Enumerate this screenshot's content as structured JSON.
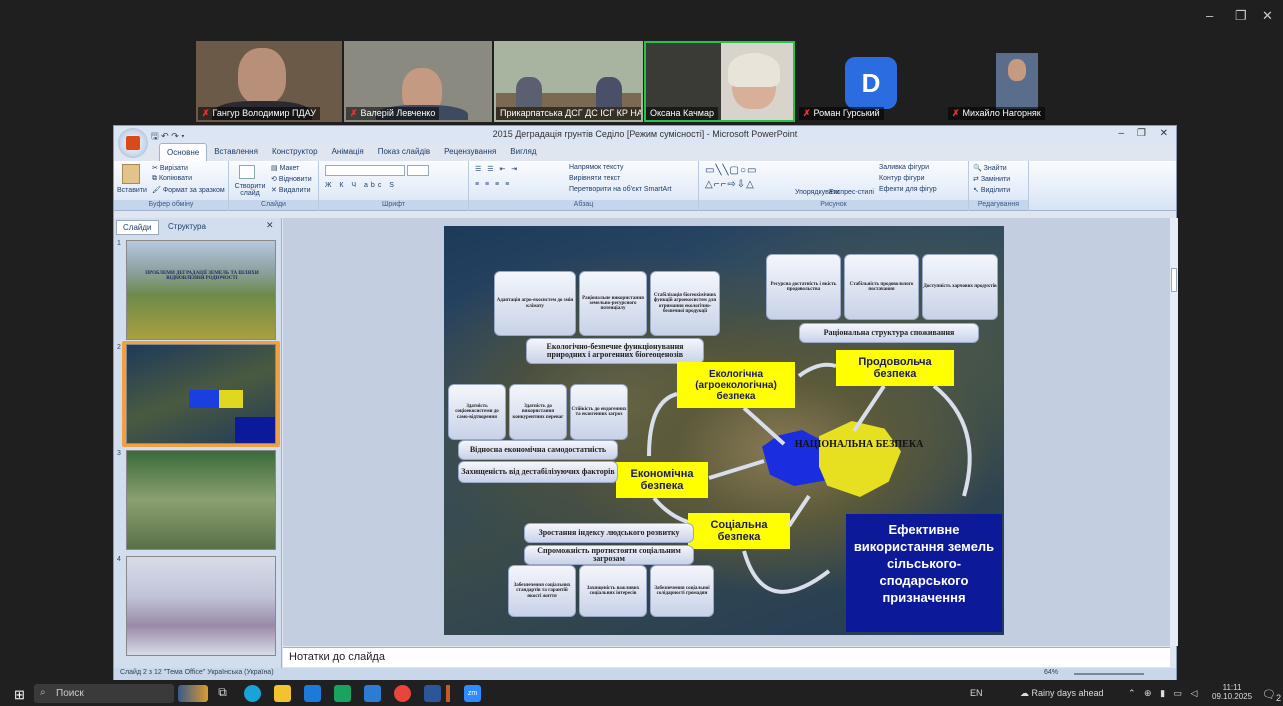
{
  "zoom_window": {
    "controls": [
      "–",
      "❐",
      "✕"
    ],
    "participants": [
      {
        "name": "Гангур Володимир ПДАУ"
      },
      {
        "name": "Валерій Левченко"
      },
      {
        "name": "Прикарпатська ДСГ ДС ІСГ КР НАА..."
      },
      {
        "name": "Оксана Качмар"
      },
      {
        "name": "Роман Гурський"
      },
      {
        "name": "Михайло Нагорняк"
      }
    ]
  },
  "ppt": {
    "title": "2015 Деградація грунтів Седіло [Режим сумісності] - Microsoft PowerPoint",
    "office_button": "",
    "window_controls": [
      "–",
      "❐",
      "✕"
    ],
    "tabs": [
      "Основне",
      "Вставлення",
      "Конструктор",
      "Анімація",
      "Показ слайдів",
      "Рецензування",
      "Вигляд"
    ],
    "ribbon": {
      "clipboard": {
        "paste": "Вставити",
        "cut": "Вирізати",
        "copy": "Копіювати",
        "format": "Формат за зразком",
        "label": "Буфер обміну"
      },
      "slides": {
        "new": "Створити слайд",
        "layout": "Макет",
        "reset": "Відновити",
        "delete": "Видалити",
        "label": "Слайди"
      },
      "font": {
        "label": "Шрифт"
      },
      "paragraph": {
        "dir": "Напрямок тексту",
        "align": "Вирівняти текст",
        "smart": "Перетворити на об'єкт SmartArt",
        "label": "Абзац"
      },
      "drawing": {
        "arrange": "Упорядкувати",
        "styles": "Експрес-стилі",
        "fill": "Заливка фігури",
        "outline": "Контур фігури",
        "effects": "Ефекти для фігур",
        "label": "Рисунок"
      },
      "editing": {
        "find": "Знайти",
        "replace": "Замінити",
        "select": "Виділити",
        "label": "Редагування"
      }
    },
    "panel_tabs": [
      "Слайди",
      "Структура"
    ],
    "thumb_numbers": [
      "1",
      "2",
      "3",
      "4"
    ],
    "thumb1_title": "ПРОБЛЕМИ ДЕГРАДАЦІЇ ЗЕМЕЛЬ ТА ШЛЯХИ ВІДНОВЛЕННЯ РОДЮЧОСТІ",
    "notes_placeholder": "Нотатки до слайда",
    "status": "Слайд 2 з 12   \"Тема Office\"   Українська (Україна)",
    "zoom": "64%"
  },
  "slide": {
    "top_left_boxes": [
      "Адаптація агро-екосистем до змін клімату",
      "Раціональне використання земельно-ресурсного потенціалу",
      "Стабілізація біогеохімічних функцій агроекосистем для отримання екологічно-безпечної продукції"
    ],
    "top_right_boxes": [
      "Ресурсна достатність і якість продовольства",
      "Стабільність продовольчого постачання",
      "Доступність харчових продуктів"
    ],
    "rational_structure": "Раціональна структура споживання",
    "eco_safe": "Екологічно-безпечне функціонування природних і агрогенних біогеоценозів",
    "ecological_security": "Екологічна (агроекологічна) безпека",
    "food_security": "Продовольча безпека",
    "mid_left_boxes": [
      "Здатність соціоекосистеми до само-відтворення",
      "Здатність до використання конкурентних переваг",
      "Стійкість до ендогенних та екзогенних загроз"
    ],
    "econ_self": "Відносна економічна самодостатність",
    "econ_protect": "Захищеність від дестабілізуючих факторів",
    "economic_security": "Економічна безпека",
    "national_security": "НАЦІОНАЛЬНА БЕЗПЕКА",
    "social_security": "Соціальна безпека",
    "hdi": "Зростання індексу людського розвитку",
    "social_threats": "Спроможність протистояти соціальним загрозам",
    "bottom_boxes": [
      "Забезпечення соціальних стандартів та гарантій якості життя",
      "Захищеність важливих соціальних інтересів",
      "Забезпечення соціальної солідарності громадян"
    ],
    "effective_use": "Ефективне використання земель сільського-сподарського призначення"
  },
  "taskbar": {
    "search": "Поиск",
    "lang": "EN",
    "weather": "Rainy days ahead",
    "time": "11:11",
    "date": "09.10.2025",
    "notif": "2"
  }
}
